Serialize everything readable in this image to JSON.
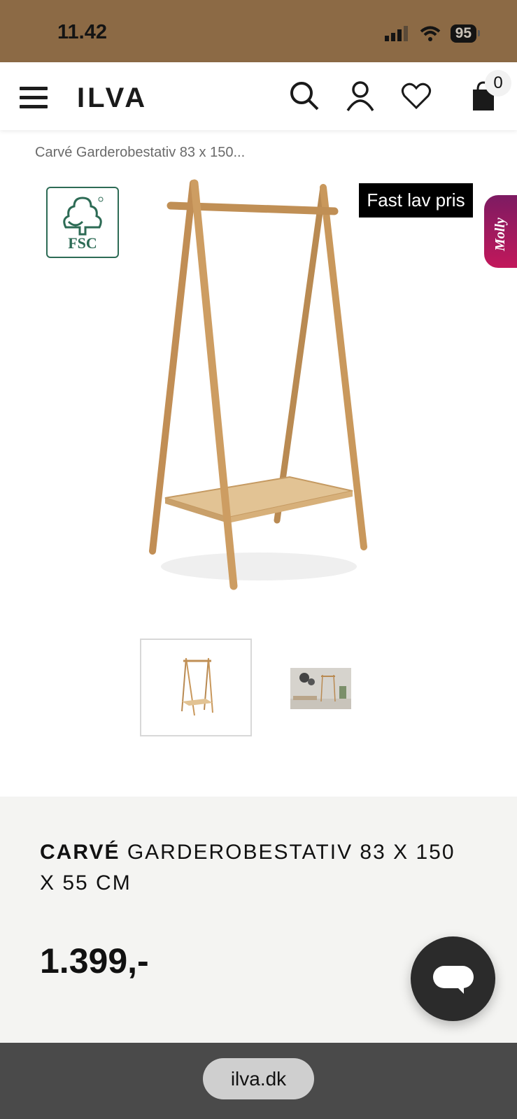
{
  "status_bar": {
    "time": "11.42",
    "battery": "95",
    "icons": [
      "signal-icon",
      "wifi-icon",
      "battery-icon"
    ]
  },
  "header": {
    "logo": "ILVA",
    "icons": [
      "menu-icon",
      "search-icon",
      "user-icon",
      "heart-icon",
      "bag-icon"
    ],
    "cart_count": "0"
  },
  "breadcrumb": {
    "current": "Carvé Garderobestativ 83 x 150..."
  },
  "product": {
    "fsc_label": "FSC",
    "badge": "Fast lav pris",
    "title_bold": "CARVÉ",
    "title_rest": "GARDEROBESTATIV 83 X 150 X 55 CM",
    "price": "1.399,-",
    "thumbnails": [
      "thumbnail-1",
      "thumbnail-2"
    ]
  },
  "side_tab": {
    "label": "Molly"
  },
  "browser": {
    "url": "ilva.dk"
  },
  "colors": {
    "status_bg": "#8c6a45",
    "info_bg": "#f4f4f2",
    "badge_bg": "#000000",
    "molly_gradient_start": "#7d1b62",
    "molly_gradient_end": "#c2185b",
    "browser_bar": "#4a4a4a"
  }
}
